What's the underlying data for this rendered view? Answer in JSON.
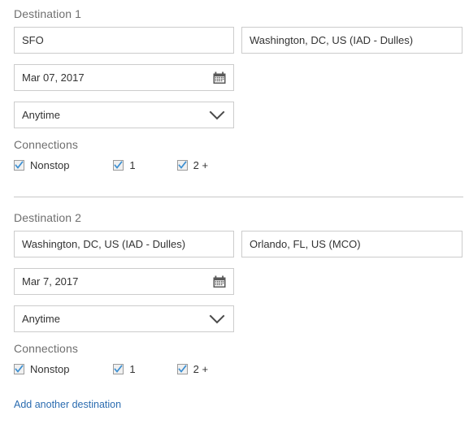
{
  "destinations": [
    {
      "section_label": "Destination 1",
      "origin": {
        "value": "SFO"
      },
      "destination": {
        "value": "Washington, DC, US (IAD - Dulles)"
      },
      "date": {
        "value": "Mar 07, 2017",
        "icon": "calendar-icon"
      },
      "time": {
        "value": "Anytime",
        "icon": "chevron-down-icon"
      },
      "connections": {
        "label": "Connections",
        "options": [
          {
            "label": "Nonstop",
            "checked": true
          },
          {
            "label": "1",
            "checked": true
          },
          {
            "label": "2 +",
            "checked": true
          }
        ]
      }
    },
    {
      "section_label": "Destination 2",
      "origin": {
        "value": "Washington, DC, US (IAD - Dulles)"
      },
      "destination": {
        "value": "Orlando, FL, US (MCO)"
      },
      "date": {
        "value": "Mar 7, 2017",
        "icon": "calendar-icon"
      },
      "time": {
        "value": "Anytime",
        "icon": "chevron-down-icon"
      },
      "connections": {
        "label": "Connections",
        "options": [
          {
            "label": "Nonstop",
            "checked": true
          },
          {
            "label": "1",
            "checked": true
          },
          {
            "label": "2 +",
            "checked": true
          }
        ]
      }
    }
  ],
  "footer": {
    "add_destination_label": "Add another destination"
  },
  "colors": {
    "label_gray": "#6f6f6f",
    "text": "#333333",
    "border": "#cccccc",
    "link_blue": "#2b6cb0",
    "check_blue": "#3d8fd1",
    "divider": "#c8c8c8",
    "icon_gray": "#595959"
  }
}
